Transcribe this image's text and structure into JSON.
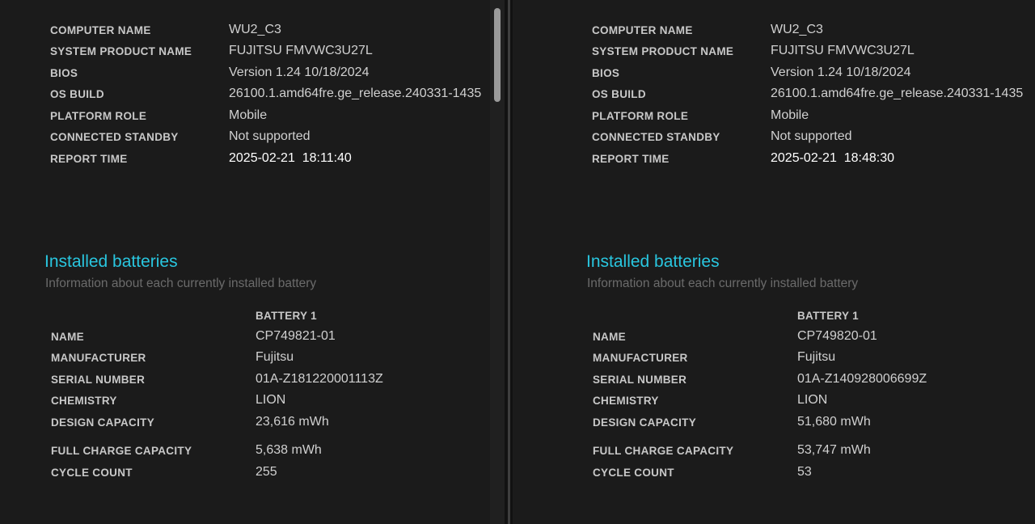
{
  "colors": {
    "background": "#191919",
    "accent": "#29c6df",
    "label": "#c8c8c8",
    "value": "#d0d0d0",
    "subtitle": "#6b6b6b"
  },
  "left": {
    "system": [
      {
        "label": "COMPUTER NAME",
        "value": "WU2_C3"
      },
      {
        "label": "SYSTEM PRODUCT NAME",
        "value": "FUJITSU FMVWC3U27L"
      },
      {
        "label": "BIOS",
        "value": "Version 1.24 10/18/2024"
      },
      {
        "label": "OS BUILD",
        "value": "26100.1.amd64fre.ge_release.240331-1435"
      },
      {
        "label": "PLATFORM ROLE",
        "value": "Mobile"
      },
      {
        "label": "CONNECTED STANDBY",
        "value": "Not supported"
      },
      {
        "label": "REPORT TIME",
        "value": "2025-02-21  18:11:40"
      }
    ],
    "batteries_title": "Installed batteries",
    "batteries_subtitle": "Information about each currently installed battery",
    "battery_header": "BATTERY 1",
    "battery": [
      {
        "label": "NAME",
        "value": "CP749821-01"
      },
      {
        "label": "MANUFACTURER",
        "value": "Fujitsu"
      },
      {
        "label": "SERIAL NUMBER",
        "value": "01A-Z181220001113Z"
      },
      {
        "label": "CHEMISTRY",
        "value": "LION"
      },
      {
        "label": "DESIGN CAPACITY",
        "value": "23,616 mWh"
      },
      {
        "label": "FULL CHARGE CAPACITY",
        "value": "5,638 mWh"
      },
      {
        "label": "CYCLE COUNT",
        "value": "255"
      }
    ]
  },
  "right": {
    "system": [
      {
        "label": "COMPUTER NAME",
        "value": "WU2_C3"
      },
      {
        "label": "SYSTEM PRODUCT NAME",
        "value": "FUJITSU FMVWC3U27L"
      },
      {
        "label": "BIOS",
        "value": "Version 1.24 10/18/2024"
      },
      {
        "label": "OS BUILD",
        "value": "26100.1.amd64fre.ge_release.240331-1435"
      },
      {
        "label": "PLATFORM ROLE",
        "value": "Mobile"
      },
      {
        "label": "CONNECTED STANDBY",
        "value": "Not supported"
      },
      {
        "label": "REPORT TIME",
        "value": "2025-02-21  18:48:30"
      }
    ],
    "batteries_title": "Installed batteries",
    "batteries_subtitle": "Information about each currently installed battery",
    "battery_header": "BATTERY 1",
    "battery": [
      {
        "label": "NAME",
        "value": "CP749820-01"
      },
      {
        "label": "MANUFACTURER",
        "value": "Fujitsu"
      },
      {
        "label": "SERIAL NUMBER",
        "value": "01A-Z140928006699Z"
      },
      {
        "label": "CHEMISTRY",
        "value": "LION"
      },
      {
        "label": "DESIGN CAPACITY",
        "value": "51,680 mWh"
      },
      {
        "label": "FULL CHARGE CAPACITY",
        "value": "53,747 mWh"
      },
      {
        "label": "CYCLE COUNT",
        "value": "53"
      }
    ]
  }
}
